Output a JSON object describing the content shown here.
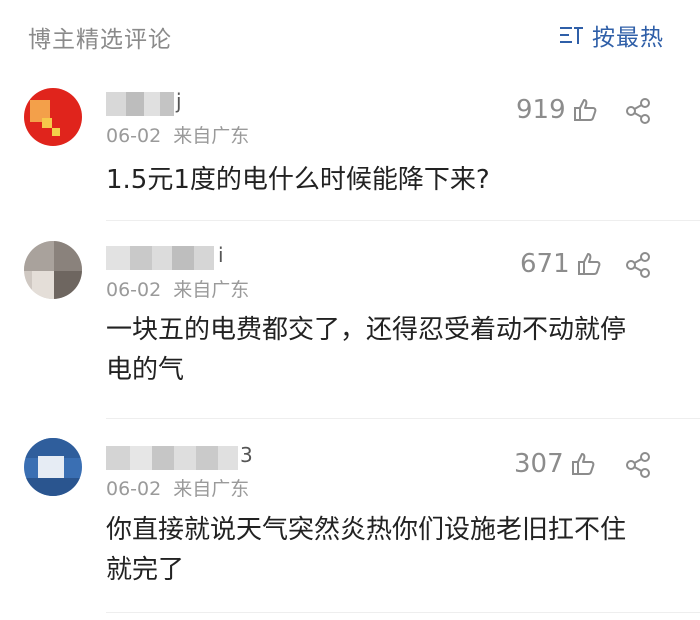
{
  "header": {
    "title": "博主精选评论",
    "sort_label": "按最热"
  },
  "colors": {
    "accent": "#2f5fa8",
    "muted": "#8a8a8a",
    "text": "#222222"
  },
  "icons": {
    "sort": "sort-lines-icon",
    "like": "thumbs-up-icon",
    "share": "share-icon"
  },
  "comments": [
    {
      "username_visible": "j",
      "date": "06-02",
      "location": "来自广东",
      "likes": "919",
      "text": "1.5元1度的电什么时候能降下来?"
    },
    {
      "username_visible": "i",
      "date": "06-02",
      "location": "来自广东",
      "likes": "671",
      "text": "一块五的电费都交了，还得忍受着动不动就停电的气"
    },
    {
      "username_visible": "3",
      "date": "06-02",
      "location": "来自广东",
      "likes": "307",
      "text": "你直接就说天气突然炎热你们设施老旧扛不住就完了"
    }
  ]
}
